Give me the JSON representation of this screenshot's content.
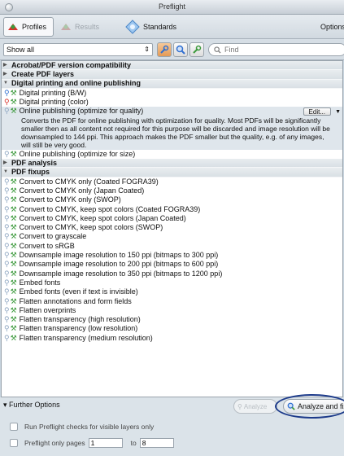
{
  "window": {
    "title": "Preflight"
  },
  "tabs": {
    "profiles": "Profiles",
    "results": "Results",
    "standards": "Standards",
    "options": "Options"
  },
  "filter": {
    "select_value": "Show all",
    "search_placeholder": "Find"
  },
  "groups": {
    "acrobat": "Acrobat/PDF version compatibility",
    "create_layers": "Create PDF layers",
    "digital": "Digital printing and online publishing",
    "analysis": "PDF analysis",
    "fixups": "PDF fixups"
  },
  "digital_items": [
    "Digital printing (B/W)",
    "Digital printing (color)",
    "Online publishing (optimize for quality)"
  ],
  "selected_description": "Converts the PDF for online publishing with optimization for quality. Most PDFs will be significantly smaller then as all content not required for this purpose will be discarded and image resolution will be downsampled to 144 ppi. This approach makes the PDF smaller but the quality, e.g. of any images, will still be very good.",
  "edit_label": "Edit...",
  "digital_after": "Online publishing (optimize for size)",
  "fixup_items": [
    "Convert to CMYK only (Coated FOGRA39)",
    "Convert to CMYK only (Japan Coated)",
    "Convert to CMYK only (SWOP)",
    "Convert to CMYK, keep spot colors (Coated FOGRA39)",
    "Convert to CMYK, keep spot colors (Japan Coated)",
    "Convert to CMYK, keep spot colors (SWOP)",
    "Convert to grayscale",
    "Convert to sRGB",
    "Downsample image resolution to 150 ppi (bitmaps to 300 ppi)",
    "Downsample image resolution to 200 ppi (bitmaps to 600 ppi)",
    "Downsample image resolution to 350 ppi (bitmaps to 1200 ppi)",
    "Embed fonts",
    "Embed fonts (even if text is invisible)",
    "Flatten annotations and form fields",
    "Flatten overprints",
    "Flatten transparency (high resolution)",
    "Flatten transparency (low resolution)",
    "Flatten transparency (medium resolution)"
  ],
  "bottom": {
    "further_options": "Further Options",
    "analyze": "Analyze",
    "analyze_and_fix": "Analyze and fix",
    "visible_layers": "Run Preflight checks for visible layers only",
    "only_pages": "Preflight only pages",
    "page_from": "1",
    "to_label": "to",
    "page_to": "8"
  },
  "colors": {
    "icon_blue": "#2f6fd1",
    "icon_red": "#d8322a",
    "icon_green": "#3c9a3c",
    "highlight": "#1c3a8a"
  }
}
